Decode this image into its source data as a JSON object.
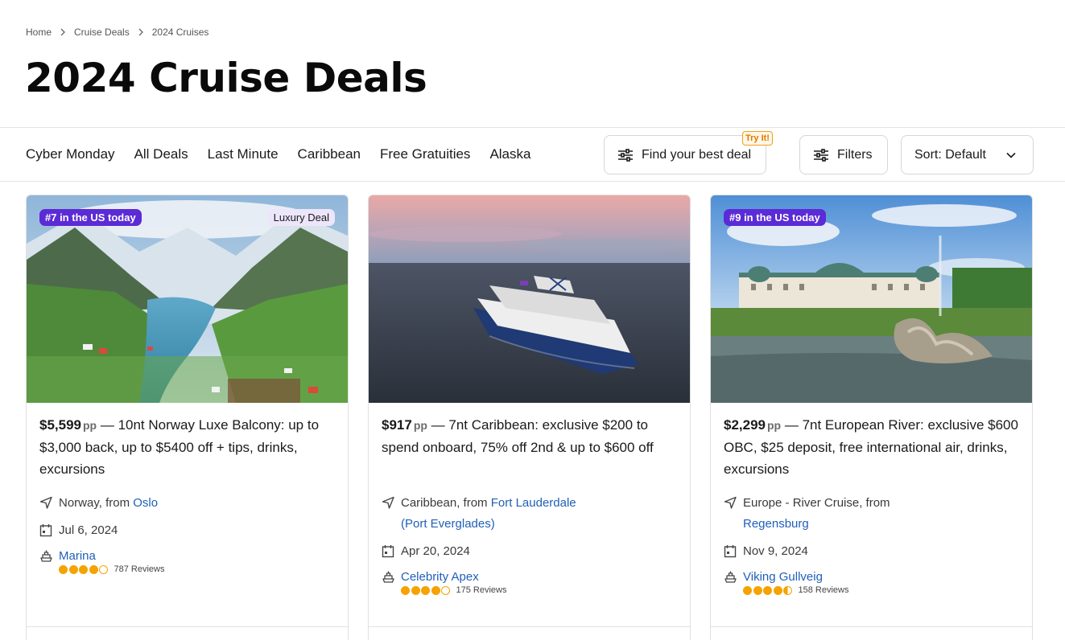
{
  "breadcrumb": [
    "Home",
    "Cruise Deals",
    "2024 Cruises"
  ],
  "page_title": "2024 Cruise Deals",
  "tabs": [
    "Cyber Monday",
    "All Deals",
    "Last Minute",
    "Caribbean",
    "Free Gratuities",
    "Alaska"
  ],
  "toolbar": {
    "best_deal_label": "Find your best deal",
    "try_badge": "Try It!",
    "filters_label": "Filters",
    "sort_label": "Sort: Default"
  },
  "cards": [
    {
      "rank_badge": "#7 in the US today",
      "extra_badge": "Luxury Deal",
      "price": "$5,599",
      "pp": "pp",
      "description": "10nt Norway Luxe Balcony: up to $3,000 back, up to $5400 off + tips, drinks, excursions",
      "destination_prefix": "Norway, from",
      "destination_port": "Oslo",
      "date": "Jul 6, 2024",
      "ship": "Marina",
      "rating": 4,
      "reviews": "787 Reviews"
    },
    {
      "rank_badge": "",
      "extra_badge": "",
      "price": "$917",
      "pp": "pp",
      "description": "7nt Caribbean: exclusive $200 to spend onboard, 75% off 2nd & up to $600 off",
      "destination_prefix": "Caribbean, from",
      "destination_port": "Fort Lauderdale (Port Everglades)",
      "date": "Apr 20, 2024",
      "ship": "Celebrity Apex",
      "rating": 4,
      "reviews": "175 Reviews"
    },
    {
      "rank_badge": "#9 in the US today",
      "extra_badge": "",
      "price": "$2,299",
      "pp": "pp",
      "description": "7nt European River: exclusive $600 OBC, $25 deposit, free international air, drinks, excursions",
      "destination_prefix": "Europe - River Cruise, from",
      "destination_port": "Regensburg",
      "date": "Nov 9, 2024",
      "ship": "Viking Gullveig",
      "rating": 4.5,
      "reviews": "158 Reviews"
    }
  ],
  "colors": {
    "badge_purple": "#5b2bd6",
    "link_blue": "#1f5fb8",
    "rating_orange": "#f5a300",
    "try_orange": "#e07b00"
  },
  "icons": [
    "chevron-right-icon",
    "sliders-icon",
    "filter-icon",
    "chevron-down-icon",
    "navigation-arrow-icon",
    "calendar-icon",
    "ship-icon"
  ]
}
